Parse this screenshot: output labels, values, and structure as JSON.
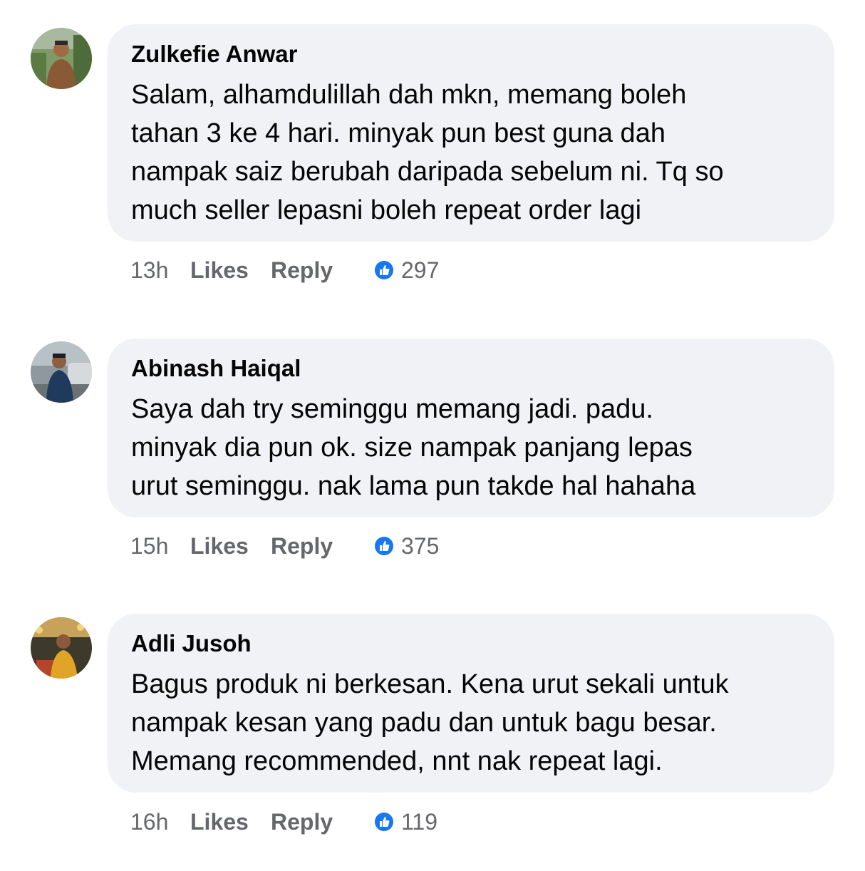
{
  "comments": [
    {
      "author": "Zulkefie Anwar",
      "lines": [
        "Salam, alhamdulillah dah mkn, memang boleh",
        "tahan 3 ke 4 hari. minyak pun best guna dah",
        "nampak saiz berubah daripada sebelum ni. Tq so",
        "much seller lepasni boleh repeat order lagi"
      ],
      "time": "13h",
      "likes_label": "Likes",
      "reply_label": "Reply",
      "reaction_icon": "like-icon",
      "reaction_count": "297",
      "avatar_colors": [
        "#6f8a55",
        "#8a5a36",
        "#2f3a2a"
      ]
    },
    {
      "author": "Abinash Haiqal",
      "lines": [
        "Saya dah try seminggu memang jadi. padu.",
        "minyak dia pun ok. size nampak panjang lepas",
        "urut seminggu. nak lama pun takde hal hahaha"
      ],
      "time": "15h",
      "likes_label": "Likes",
      "reply_label": "Reply",
      "reaction_icon": "like-icon",
      "reaction_count": "375",
      "avatar_colors": [
        "#9aa3a8",
        "#1f3a5c",
        "#c8ccd0"
      ]
    },
    {
      "author": "Adli Jusoh",
      "lines": [
        "Bagus produk ni berkesan. Kena urut sekali untuk",
        "nampak kesan yang padu dan untuk bagu besar.",
        "Memang recommended, nnt nak repeat lagi."
      ],
      "time": "16h",
      "likes_label": "Likes",
      "reply_label": "Reply",
      "reaction_icon": "like-icon",
      "reaction_count": "119",
      "avatar_colors": [
        "#3d3a2c",
        "#e0a526",
        "#b5452a"
      ]
    }
  ],
  "colors": {
    "bubble_bg": "#f0f2f5",
    "text": "#050505",
    "meta": "#65676b",
    "like_blue": "#1877f2"
  }
}
